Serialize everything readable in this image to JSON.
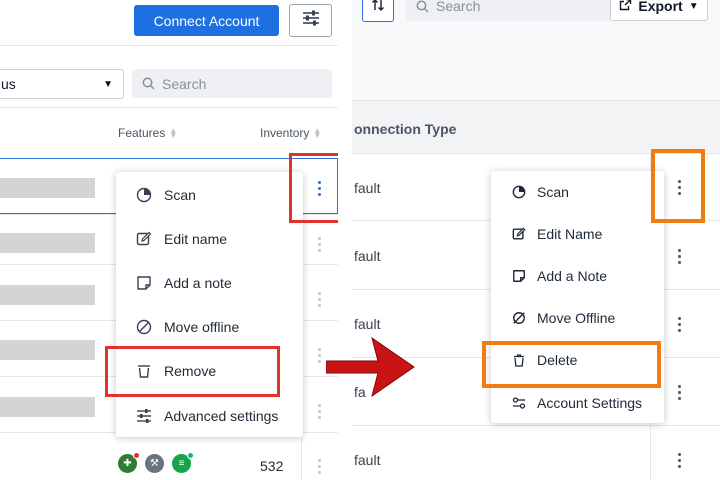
{
  "left": {
    "connect_label": "Connect Account",
    "status_value": "us",
    "search_placeholder": "Search",
    "columns": {
      "features": "Features",
      "inventory": "Inventory"
    },
    "menu": {
      "items": [
        "Scan",
        "Edit name",
        "Add a note",
        "Move offline",
        "Remove",
        "Advanced settings"
      ]
    },
    "inventory_value": "532",
    "highlight_color": "#e0342a",
    "accent": "#1e6fe0"
  },
  "right": {
    "search_placeholder": "Search",
    "export_label": "Export",
    "column_header": "onnection Type",
    "rows": [
      "fault",
      "fault",
      "fault",
      "fa",
      "fault"
    ],
    "menu": {
      "items": [
        "Scan",
        "Edit Name",
        "Add a Note",
        "Move Offline",
        "Delete",
        "Account Settings"
      ]
    },
    "highlight_color": "#f07d12"
  },
  "arrow": {
    "color": "#c81414",
    "direction": "right"
  }
}
